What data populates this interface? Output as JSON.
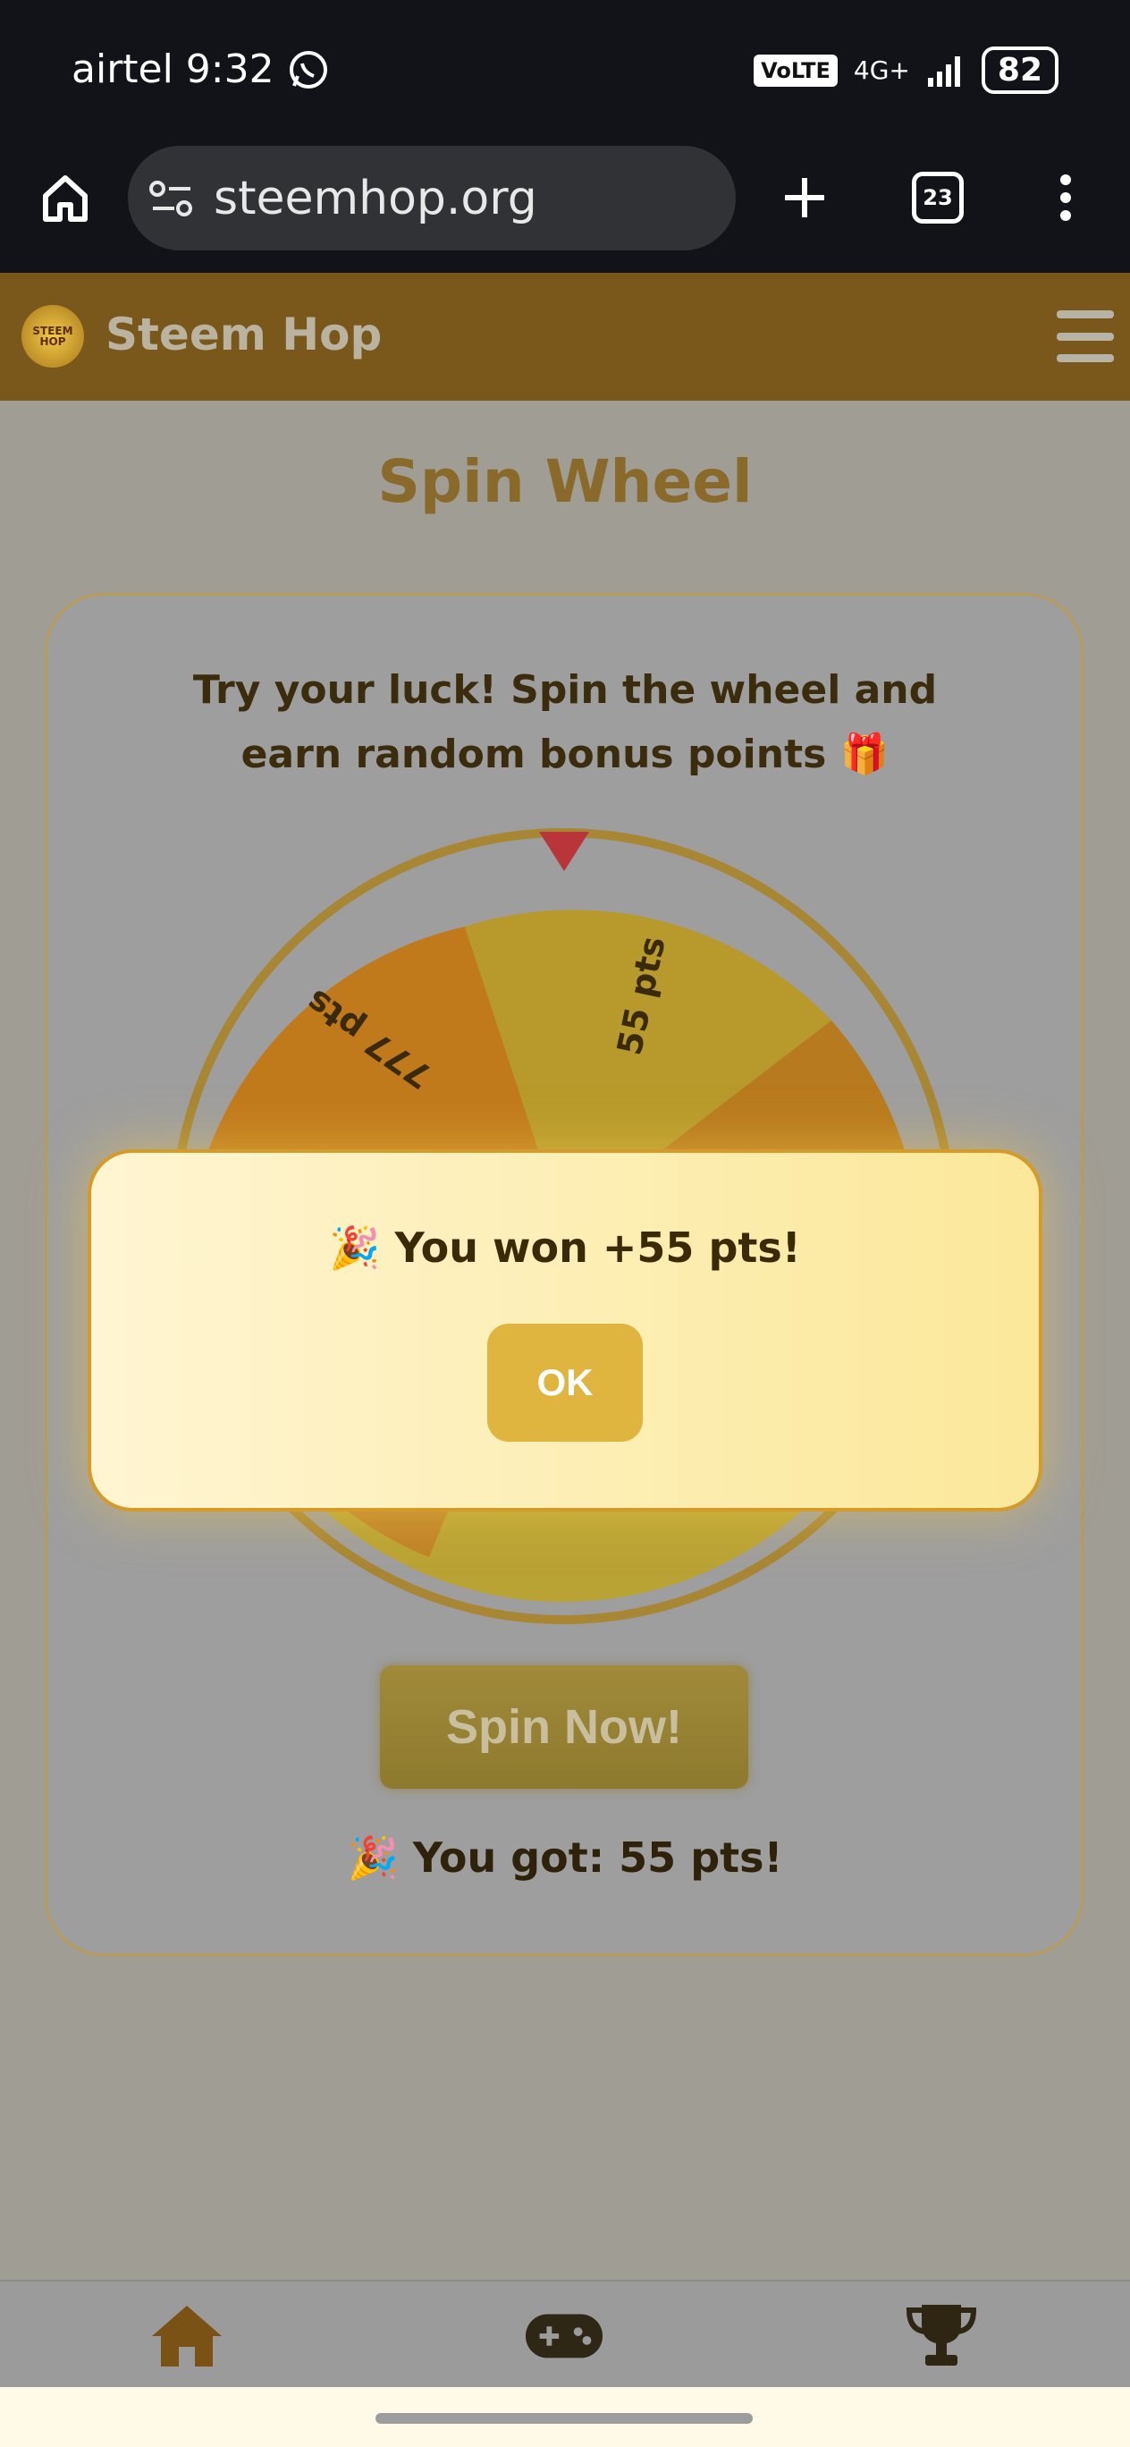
{
  "status_bar": {
    "carrier_time": "airtel 9:32",
    "network": "VoLTE",
    "signal": "4G+",
    "battery": "82"
  },
  "browser": {
    "url": "steemhop.org",
    "tab_count": "23"
  },
  "app": {
    "logo_text": "STEEM HOP",
    "title": "Steem Hop"
  },
  "page": {
    "title": "Spin Wheel",
    "description": "Try your luck! Spin the wheel and earn random bonus points 🎁",
    "spin_button": "Spin Now!",
    "result": "🎉 You got: 55 pts!"
  },
  "wheel": {
    "segments": [
      {
        "label": "777 pts",
        "color": "#c07a1c"
      },
      {
        "label": "55 pts",
        "color": "#b79a2b"
      },
      {
        "label": "",
        "color": "#b87a1e"
      }
    ],
    "pointer_color": "#b8353a"
  },
  "modal": {
    "message": "🎉 You won +55 pts!",
    "ok_label": "OK"
  },
  "nav": {
    "icons": [
      "home-icon",
      "gamepad-icon",
      "trophy-icon"
    ]
  },
  "colors": {
    "header": "#7a571b",
    "accent": "#e0b53f",
    "title": "#8a6a2a"
  }
}
